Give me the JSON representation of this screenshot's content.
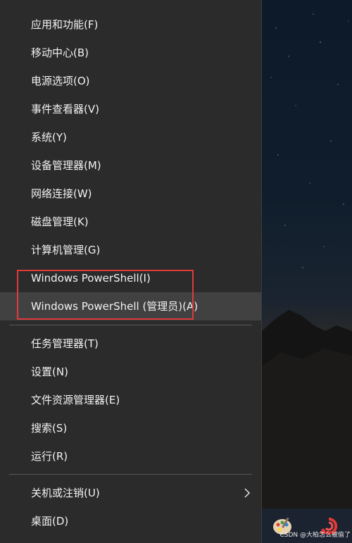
{
  "menu": {
    "items": [
      {
        "label": "应用和功能(F)"
      },
      {
        "label": "移动中心(B)"
      },
      {
        "label": "电源选项(O)"
      },
      {
        "label": "事件查看器(V)"
      },
      {
        "label": "系统(Y)"
      },
      {
        "label": "设备管理器(M)"
      },
      {
        "label": "网络连接(W)"
      },
      {
        "label": "磁盘管理(K)"
      },
      {
        "label": "计算机管理(G)"
      },
      {
        "label": "Windows PowerShell(I)"
      },
      {
        "label": "Windows PowerShell (管理员)(A)"
      },
      {
        "label": "任务管理器(T)"
      },
      {
        "label": "设置(N)"
      },
      {
        "label": "文件资源管理器(E)"
      },
      {
        "label": "搜索(S)"
      },
      {
        "label": "运行(R)"
      },
      {
        "label": "关机或注销(U)",
        "submenu": true
      },
      {
        "label": "桌面(D)"
      }
    ],
    "hovered_item": "Windows PowerShell (管理员)(A)",
    "highlight_color": "#e03a3a"
  },
  "taskbar": {
    "icons": [
      "paint-palette-icon",
      "red-snail-app-icon"
    ]
  },
  "watermark": "CSDN @大柏怎么被偷了"
}
